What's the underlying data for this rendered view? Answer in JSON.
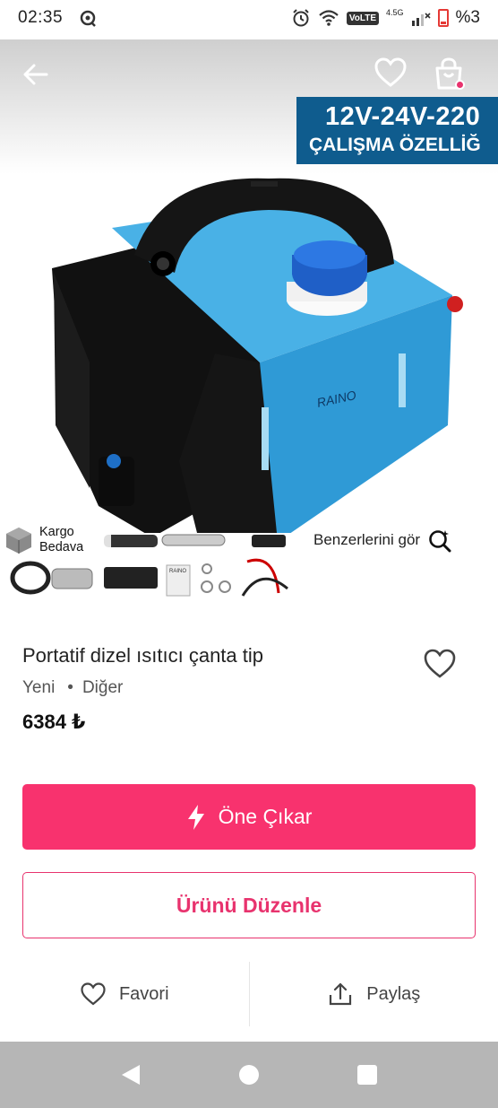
{
  "status_bar": {
    "time": "02:35",
    "network": "VoLTE",
    "network_gen": "4.5G",
    "battery": "%3"
  },
  "hero": {
    "banner_line1": "12V-24V-220",
    "banner_line2": "ÇALIŞMA ÖZELLİĞ",
    "brand_on_device": "RAINO",
    "parts_label": "RAINO",
    "kargo_line1": "Kargo",
    "kargo_line2": "Bedava",
    "similar_label": "Benzerlerini gör"
  },
  "product": {
    "title": "Portatif dizel ısıtıcı çanta tip",
    "condition": "Yeni",
    "category": "Diğer",
    "price": "6384 ₺"
  },
  "buttons": {
    "promote": "Öne Çıkar",
    "edit": "Ürünü Düzenle",
    "favorite": "Favori",
    "share": "Paylaş"
  },
  "colors": {
    "accent": "#f8326e",
    "accent_text": "#e8336e",
    "device_blue": "#3aa6df",
    "banner_blue": "#0f5c8e"
  },
  "icons": {
    "back": "arrow-left-icon",
    "favorite": "heart-icon",
    "cart": "shopping-bag-icon",
    "similar": "magnifier-sparkle-icon",
    "promote": "lightning-icon",
    "share": "share-upload-icon"
  }
}
